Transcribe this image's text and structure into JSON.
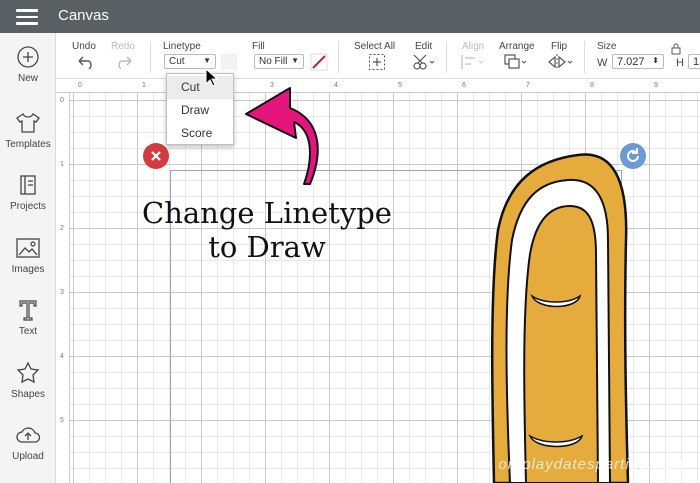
{
  "titlebar": {
    "title": "Canvas"
  },
  "sidebar": {
    "items": [
      {
        "label": "New",
        "icon": "plus-circle-icon"
      },
      {
        "label": "Templates",
        "icon": "tshirt-icon"
      },
      {
        "label": "Projects",
        "icon": "projects-icon"
      },
      {
        "label": "Images",
        "icon": "images-icon"
      },
      {
        "label": "Text",
        "icon": "text-icon"
      },
      {
        "label": "Shapes",
        "icon": "shapes-icon"
      },
      {
        "label": "Upload",
        "icon": "upload-cloud-icon"
      }
    ]
  },
  "toolbar": {
    "undo": "Undo",
    "redo": "Redo",
    "linetype_label": "Linetype",
    "linetype_value": "Cut",
    "fill_label": "Fill",
    "fill_value": "No Fill",
    "select_all": "Select All",
    "edit": "Edit",
    "align": "Align",
    "arrange": "Arrange",
    "flip": "Flip",
    "size_label": "Size",
    "size_w_label": "W",
    "size_w_value": "7.027",
    "size_h_label": "H",
    "size_h_value": "1"
  },
  "ruler": {
    "top": [
      "0",
      "1",
      "2",
      "3",
      "4",
      "5",
      "6",
      "7",
      "8",
      "9"
    ],
    "left": [
      "0",
      "1",
      "2",
      "3",
      "4",
      "5"
    ]
  },
  "dropdown": {
    "options": [
      "Cut",
      "Draw",
      "Score"
    ],
    "selected": "Cut"
  },
  "annotation": {
    "line1": "Change Linetype",
    "line2": "to Draw"
  },
  "watermark": "on.playdatesparties.com",
  "colors": {
    "titlebar": "#5a5f63",
    "shape_fill": "#e5ab3c",
    "arrow": "#e6157e",
    "delete_button": "#d23b3f",
    "rotate_button": "#6c9ad6"
  }
}
